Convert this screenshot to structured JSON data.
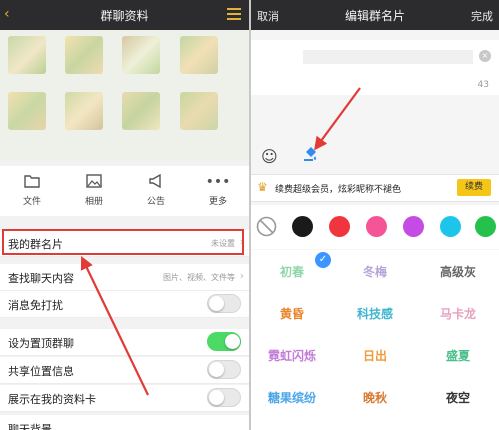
{
  "left": {
    "header": {
      "title": "群聊资料",
      "menu_icon": "menu-icon"
    },
    "actions": [
      {
        "label": "文件",
        "icon": "folder-icon"
      },
      {
        "label": "相册",
        "icon": "image-icon"
      },
      {
        "label": "公告",
        "icon": "megaphone-icon"
      },
      {
        "label": "更多",
        "icon": "more-icon"
      }
    ],
    "rows": [
      {
        "label": "我的群名片",
        "value": "未设置"
      },
      {
        "label": "查找聊天内容",
        "value": "图片、视频、文件等"
      },
      {
        "label": "消息免打扰"
      },
      {
        "label": "设为置顶群聊"
      },
      {
        "label": "共享位置信息"
      },
      {
        "label": "展示在我的资料卡"
      },
      {
        "label": "聊天背景"
      }
    ],
    "toggles": {
      "mute": false,
      "pin": true,
      "share_location": false,
      "show_card": false
    }
  },
  "right": {
    "header": {
      "cancel": "取消",
      "title": "编辑群名片",
      "done": "完成"
    },
    "char_count": "43",
    "vip": {
      "text": "续费超级会员，炫彩昵称不褪色",
      "button": "续费"
    },
    "swatches": [
      "#1a1a1a",
      "#f0353f",
      "#f35596",
      "#c44be3",
      "#1ec5ea",
      "#26c14c"
    ],
    "styles": [
      {
        "label": "初春",
        "color": "#8fd6a8"
      },
      {
        "label": "冬梅",
        "color": "#b6a3d9"
      },
      {
        "label": "高级灰",
        "color": "#666666"
      },
      {
        "label": "黄昏",
        "color": "#e9852b"
      },
      {
        "label": "科技感",
        "color": "#3fb6cf"
      },
      {
        "label": "马卡龙",
        "color": "#e8a0c0"
      },
      {
        "label": "霓虹闪烁",
        "color": "#c27bd8"
      },
      {
        "label": "日出",
        "color": "#f09a3a"
      },
      {
        "label": "盛夏",
        "color": "#4bbf8b"
      },
      {
        "label": "糖果缤纷",
        "color": "#4ca6e8"
      },
      {
        "label": "晚秋",
        "color": "#d67a34"
      },
      {
        "label": "夜空",
        "color": "#333333"
      }
    ]
  },
  "colors": {
    "accent": "#e0b23a",
    "highlight": "#e23a34",
    "toggle_on": "#4cd964",
    "vip_button": "#f5c518"
  }
}
